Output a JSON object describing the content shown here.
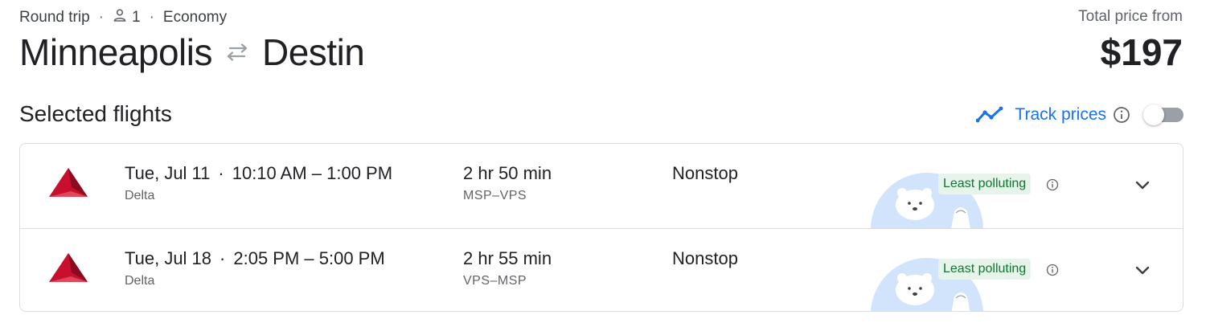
{
  "header": {
    "trip_type": "Round trip",
    "passengers": "1",
    "cabin": "Economy",
    "origin": "Minneapolis",
    "destination": "Destin",
    "price_label": "Total price from",
    "price": "$197"
  },
  "selected": {
    "title": "Selected flights",
    "track_label": "Track prices",
    "track_enabled": false
  },
  "flights": [
    {
      "date": "Tue, Jul 11",
      "times": "10:10 AM – 1:00 PM",
      "airline": "Delta",
      "duration": "2 hr 50 min",
      "airports": "MSP–VPS",
      "stops": "Nonstop",
      "badge": "Least polluting"
    },
    {
      "date": "Tue, Jul 18",
      "times": "2:05 PM – 5:00 PM",
      "airline": "Delta",
      "duration": "2 hr 55 min",
      "airports": "VPS–MSP",
      "stops": "Nonstop",
      "badge": "Least polluting"
    }
  ],
  "icons": {
    "person": "person-icon",
    "swap": "swap-arrows-icon",
    "trend": "trend-line-icon",
    "info": "info-icon",
    "airline_logo": "delta-logo-icon",
    "bear": "polar-bear-illustration",
    "expand": "chevron-down-icon"
  },
  "colors": {
    "accent": "#1a73e8",
    "eco_badge_bg": "#e6f4ea",
    "eco_badge_text": "#137333",
    "delta_red": "#c8102e",
    "toggle_rail": "#9aa0a6"
  }
}
